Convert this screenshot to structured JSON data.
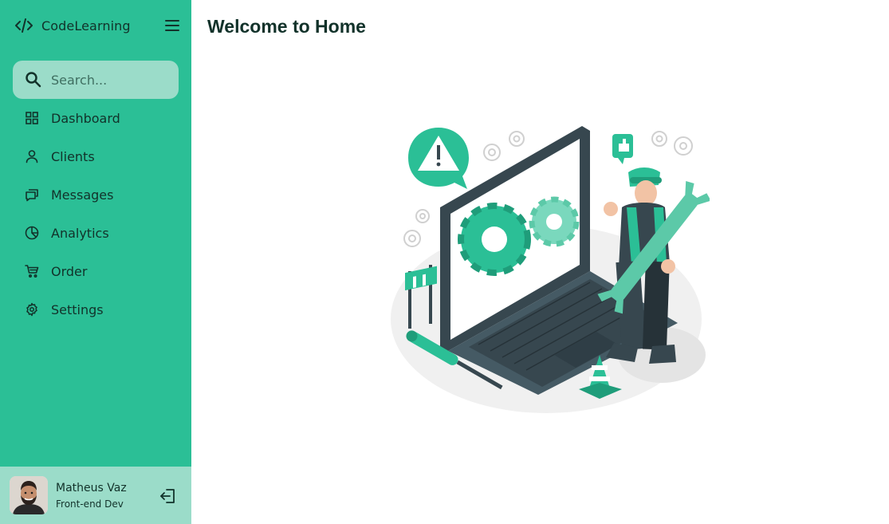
{
  "app": {
    "name": "CodeLearning",
    "logo_icon": "code-icon"
  },
  "search": {
    "placeholder": "Search..."
  },
  "sidebar": {
    "items": [
      {
        "label": "Dashboard",
        "icon": "grid-icon"
      },
      {
        "label": "Clients",
        "icon": "user-icon"
      },
      {
        "label": "Messages",
        "icon": "chat-icon"
      },
      {
        "label": "Analytics",
        "icon": "pie-chart-icon"
      },
      {
        "label": "Order",
        "icon": "cart-icon"
      },
      {
        "label": "Settings",
        "icon": "gear-icon"
      }
    ]
  },
  "profile": {
    "name": "Matheus Vaz",
    "role": "Front-end Dev"
  },
  "main": {
    "title": "Welcome to Home"
  },
  "colors": {
    "sidebar": "#2bbf96",
    "accent_light": "#9bdcc9",
    "text_dark": "#12322a",
    "illustration_dark": "#37474f"
  }
}
